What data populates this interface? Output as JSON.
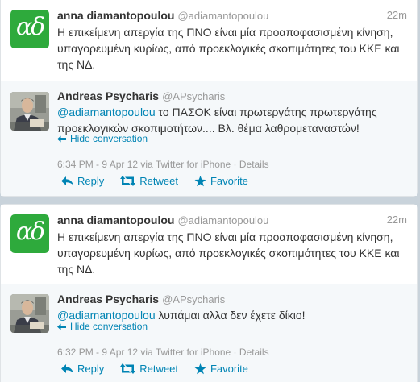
{
  "groups": [
    {
      "parent": {
        "name": "anna diamantopoulou",
        "handle": "@adiamantopoulou",
        "time": "22m",
        "avatar_text": "αδ",
        "text": "Η επικείμενη απεργία της ΠΝΟ είναι μία προαποφασισμένη κίνηση, υπαγορευμένη κυρίως, από προεκλογικές σκοπιμότητες του ΚΚΕ και της ΝΔ."
      },
      "reply": {
        "name": "Andreas Psycharis",
        "handle": "@APsycharis",
        "mention": "@adiamantopoulou",
        "text": " το ΠΑΣΟΚ είναι πρωτεργάτης πρωτεργάτης προεκλογικών σκοπιμοτήτων.... Βλ. θέμα λαθρομεταναστών!",
        "hide_label": "Hide conversation",
        "meta": "6:34 PM - 9 Apr 12 via Twitter for iPhone · Details",
        "reply_label": "Reply",
        "retweet_label": "Retweet",
        "favorite_label": "Favorite"
      }
    },
    {
      "parent": {
        "name": "anna diamantopoulou",
        "handle": "@adiamantopoulou",
        "time": "22m",
        "avatar_text": "αδ",
        "text": "Η επικείμενη απεργία της ΠΝΟ είναι μία προαποφασισμένη κίνηση, υπαγορευμένη κυρίως, από προεκλογικές σκοπιμότητες του ΚΚΕ και της ΝΔ."
      },
      "reply": {
        "name": "Andreas Psycharis",
        "handle": "@APsycharis",
        "mention": "@adiamantopoulou",
        "text": " λυπάμαι αλλα δεν έχετε δίκιο!",
        "hide_label": "Hide conversation",
        "meta": "6:32 PM - 9 Apr 12 via Twitter for iPhone · Details",
        "reply_label": "Reply",
        "retweet_label": "Retweet",
        "favorite_label": "Favorite"
      }
    }
  ],
  "colors": {
    "link": "#0084b4",
    "avatar_green": "#2eaa3c",
    "background": "#c9d3db"
  }
}
